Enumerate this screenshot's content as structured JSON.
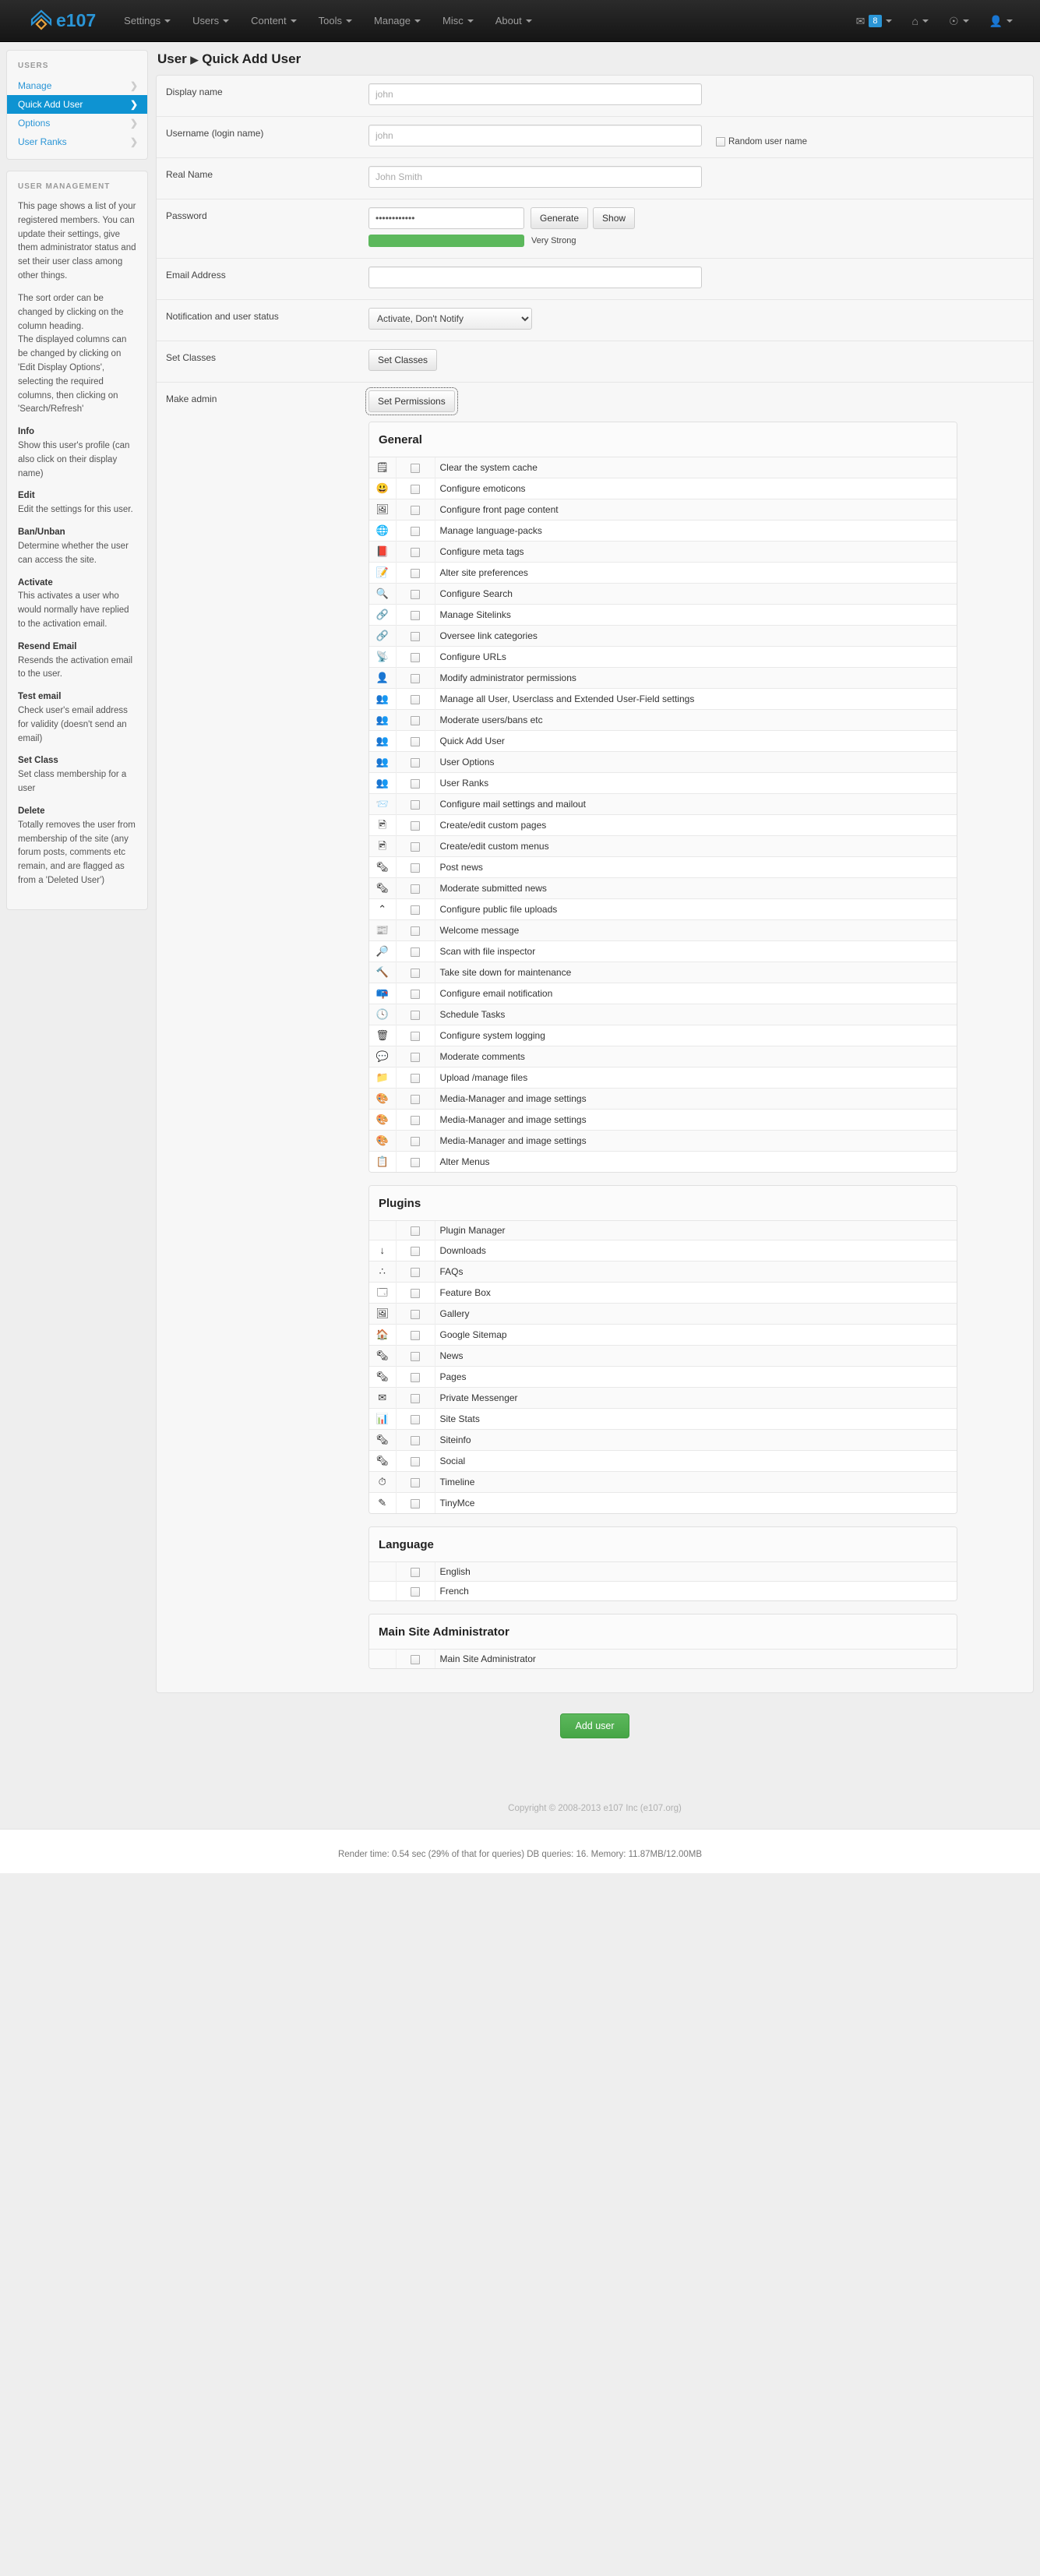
{
  "navbar": {
    "brand": "e107",
    "items": [
      {
        "label": "Settings",
        "caret": true
      },
      {
        "label": "Users",
        "caret": true
      },
      {
        "label": "Content",
        "caret": true
      },
      {
        "label": "Tools",
        "caret": true
      },
      {
        "label": "Manage",
        "caret": true
      },
      {
        "label": "Misc",
        "caret": true
      },
      {
        "label": "About",
        "caret": true
      }
    ],
    "right": {
      "mail_icon": "envelope-icon",
      "mail_count": "8",
      "home_icon": "home-icon",
      "globe_icon": "globe-icon",
      "user_icon": "user-icon"
    }
  },
  "sidebar": {
    "nav_heading": "USERS",
    "nav_items": [
      {
        "label": "Manage",
        "active": false
      },
      {
        "label": "Quick Add User",
        "active": true
      },
      {
        "label": "Options",
        "active": false
      },
      {
        "label": "User Ranks",
        "active": false
      }
    ],
    "help_heading": "USER MANAGEMENT",
    "help_paragraphs": [
      "This page shows a list of your registered members. You can update their settings, give them administrator status and set their user class among other things.",
      "The sort order can be changed by clicking on the column heading.\nThe displayed columns can be changed by clicking on 'Edit Display Options', selecting the required columns, then clicking on 'Search/Refresh'"
    ],
    "help_items": [
      {
        "title": "Info",
        "text": "Show this user's profile (can also click on their display name)"
      },
      {
        "title": "Edit",
        "text": "Edit the settings for this user."
      },
      {
        "title": "Ban/Unban",
        "text": "Determine whether the user can access the site."
      },
      {
        "title": "Activate",
        "text": "This activates a user who would normally have replied to the activation email."
      },
      {
        "title": "Resend Email",
        "text": "Resends the activation email to the user."
      },
      {
        "title": "Test email",
        "text": "Check user's email address for validity (doesn't send an email)"
      },
      {
        "title": "Set Class",
        "text": "Set class membership for a user"
      },
      {
        "title": "Delete",
        "text": "Totally removes the user from membership of the site (any forum posts, comments etc remain, and are flagged as from a 'Deleted User')"
      }
    ]
  },
  "main": {
    "breadcrumb_root": "User",
    "breadcrumb_sep": "▶",
    "breadcrumb_current": "Quick Add User",
    "fields": {
      "display_name": {
        "label": "Display name",
        "placeholder": "john",
        "value": ""
      },
      "username": {
        "label": "Username (login name)",
        "placeholder": "john",
        "value": ""
      },
      "random_username": {
        "label": "Random user name",
        "checked": false
      },
      "real_name": {
        "label": "Real Name",
        "placeholder": "John Smith",
        "value": ""
      },
      "password": {
        "label": "Password",
        "value": "ooooooooooo",
        "generate_label": "Generate",
        "show_label": "Show",
        "strength_label": "Very Strong",
        "strength_color": "#5cb85c"
      },
      "email": {
        "label": "Email Address",
        "placeholder": "",
        "value": ""
      },
      "notification": {
        "label": "Notification and user status",
        "selected": "Activate, Don't Notify",
        "options": [
          "Activate, Don't Notify"
        ]
      },
      "set_classes": {
        "label": "Set Classes",
        "button": "Set Classes"
      },
      "make_admin": {
        "label": "Make admin",
        "button": "Set Permissions"
      }
    },
    "submit_label": "Add user"
  },
  "permissions": [
    {
      "title": "General",
      "rows": [
        {
          "icon": "🗒",
          "icon_name": "cache-icon",
          "label": "Clear the system cache",
          "checked": false
        },
        {
          "icon": "😃",
          "icon_name": "emoticon-icon",
          "label": "Configure emoticons",
          "checked": false
        },
        {
          "icon": "🖼",
          "icon_name": "front-page-icon",
          "label": "Configure front page content",
          "checked": false
        },
        {
          "icon": "🌐",
          "icon_name": "language-pack-icon",
          "label": "Manage language-packs",
          "checked": false
        },
        {
          "icon": "📕",
          "icon_name": "meta-tags-icon",
          "label": "Configure meta tags",
          "checked": false
        },
        {
          "icon": "📝",
          "icon_name": "site-preferences-icon",
          "label": "Alter site preferences",
          "checked": false
        },
        {
          "icon": "🔍",
          "icon_name": "search-icon",
          "label": "Configure Search",
          "checked": false
        },
        {
          "icon": "🔗",
          "icon_name": "sitelinks-icon",
          "label": "Manage Sitelinks",
          "checked": false
        },
        {
          "icon": "🔗",
          "icon_name": "link-categories-icon",
          "label": "Oversee link categories",
          "checked": false
        },
        {
          "icon": "📡",
          "icon_name": "urls-icon",
          "label": "Configure URLs",
          "checked": false
        },
        {
          "icon": "👤",
          "icon_name": "admin-permissions-icon",
          "label": "Modify administrator permissions",
          "checked": false
        },
        {
          "icon": "👥",
          "icon_name": "user-settings-icon",
          "label": "Manage all User, Userclass and Extended User-Field settings",
          "checked": false
        },
        {
          "icon": "👥",
          "icon_name": "moderate-users-icon",
          "label": "Moderate users/bans etc",
          "checked": false
        },
        {
          "icon": "👥",
          "icon_name": "quick-add-user-icon",
          "label": "Quick Add User",
          "checked": false
        },
        {
          "icon": "👥",
          "icon_name": "user-options-icon",
          "label": "User Options",
          "checked": false
        },
        {
          "icon": "👥",
          "icon_name": "user-ranks-icon",
          "label": "User Ranks",
          "checked": false
        },
        {
          "icon": "📨",
          "icon_name": "mail-settings-icon",
          "label": "Configure mail settings and mailout",
          "checked": false
        },
        {
          "icon": "🖻",
          "icon_name": "custom-pages-icon",
          "label": "Create/edit custom pages",
          "checked": false
        },
        {
          "icon": "🖻",
          "icon_name": "custom-menus-icon",
          "label": "Create/edit custom menus",
          "checked": false
        },
        {
          "icon": "🗞",
          "icon_name": "post-news-icon",
          "label": "Post news",
          "checked": false
        },
        {
          "icon": "🗞",
          "icon_name": "moderate-news-icon",
          "label": "Moderate submitted news",
          "checked": false
        },
        {
          "icon": "⌃",
          "icon_name": "file-upload-icon",
          "label": "Configure public file uploads",
          "checked": false
        },
        {
          "icon": "📰",
          "icon_name": "welcome-message-icon",
          "label": "Welcome message",
          "checked": false
        },
        {
          "icon": "🔎",
          "icon_name": "file-inspector-icon",
          "label": "Scan with file inspector",
          "checked": false
        },
        {
          "icon": "🔨",
          "icon_name": "maintenance-icon",
          "label": "Take site down for maintenance",
          "checked": false
        },
        {
          "icon": "📪",
          "icon_name": "email-notification-icon",
          "label": "Configure email notification",
          "checked": false
        },
        {
          "icon": "🕓",
          "icon_name": "schedule-tasks-icon",
          "label": "Schedule Tasks",
          "checked": false
        },
        {
          "icon": "🗑",
          "icon_name": "system-logging-icon",
          "label": "Configure system logging",
          "checked": false
        },
        {
          "icon": "💬",
          "icon_name": "moderate-comments-icon",
          "label": "Moderate comments",
          "checked": false
        },
        {
          "icon": "📁",
          "icon_name": "file-manager-icon",
          "label": "Upload /manage files",
          "checked": false
        },
        {
          "icon": "🎨",
          "icon_name": "media-manager-icon",
          "label": "Media-Manager and image settings",
          "checked": false
        },
        {
          "icon": "🎨",
          "icon_name": "media-manager-icon",
          "label": "Media-Manager and image settings",
          "checked": false
        },
        {
          "icon": "🎨",
          "icon_name": "media-manager-icon",
          "label": "Media-Manager and image settings",
          "checked": false
        },
        {
          "icon": "📋",
          "icon_name": "alter-menus-icon",
          "label": "Alter Menus",
          "checked": false
        }
      ]
    },
    {
      "title": "Plugins",
      "rows": [
        {
          "icon": "",
          "icon_name": "plugin-manager-icon",
          "label": "Plugin Manager",
          "checked": false
        },
        {
          "icon": "↓",
          "icon_name": "downloads-icon",
          "label": "Downloads",
          "checked": false
        },
        {
          "icon": "∴",
          "icon_name": "faqs-icon",
          "label": "FAQs",
          "checked": false
        },
        {
          "icon": "🗔",
          "icon_name": "feature-box-icon",
          "label": "Feature Box",
          "checked": false
        },
        {
          "icon": "🖼",
          "icon_name": "gallery-icon",
          "label": "Gallery",
          "checked": false
        },
        {
          "icon": "🏠",
          "icon_name": "google-sitemap-icon",
          "label": "Google Sitemap",
          "checked": false
        },
        {
          "icon": "🗞",
          "icon_name": "news-icon",
          "label": "News",
          "checked": false
        },
        {
          "icon": "🗞",
          "icon_name": "pages-icon",
          "label": "Pages",
          "checked": false
        },
        {
          "icon": "✉",
          "icon_name": "private-messenger-icon",
          "label": "Private Messenger",
          "checked": false
        },
        {
          "icon": "📊",
          "icon_name": "site-stats-icon",
          "label": "Site Stats",
          "checked": false
        },
        {
          "icon": "🗞",
          "icon_name": "siteinfo-icon",
          "label": "Siteinfo",
          "checked": false
        },
        {
          "icon": "🗞",
          "icon_name": "social-icon",
          "label": "Social",
          "checked": false
        },
        {
          "icon": "⏱",
          "icon_name": "timeline-icon",
          "label": "Timeline",
          "checked": false
        },
        {
          "icon": "✎",
          "icon_name": "tinymce-icon",
          "label": "TinyMce",
          "checked": false
        }
      ]
    },
    {
      "title": "Language",
      "rows": [
        {
          "icon": "",
          "icon_name": "language-english-icon",
          "label": "English",
          "checked": false
        },
        {
          "icon": "",
          "icon_name": "language-french-icon",
          "label": "French",
          "checked": false
        }
      ]
    },
    {
      "title": "Main Site Administrator",
      "rows": [
        {
          "icon": "",
          "icon_name": "main-site-admin-icon",
          "label": "Main Site Administrator",
          "checked": false
        }
      ]
    }
  ],
  "footer": {
    "copyright": "Copyright © 2008-2013 e107 Inc (e107.org)",
    "render": "Render time: 0.54 sec (29% of that for queries) DB queries: 16. Memory: 11.87MB/12.00MB"
  }
}
